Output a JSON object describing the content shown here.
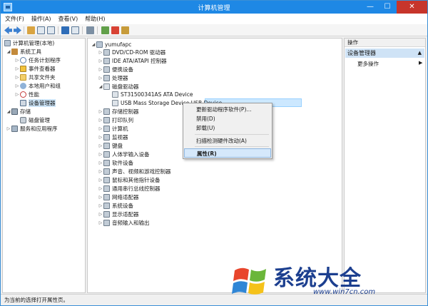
{
  "window": {
    "title": "计算机管理",
    "minimize": "—",
    "maximize": "☐",
    "close": "✕"
  },
  "menu": [
    "文件(F)",
    "操作(A)",
    "查看(V)",
    "帮助(H)"
  ],
  "left_tree": {
    "root": "计算机管理(本地)",
    "system_tools": "系统工具",
    "task_scheduler": "任务计划程序",
    "event_viewer": "事件查看器",
    "shared_folders": "共享文件夹",
    "local_users": "本地用户和组",
    "performance": "性能",
    "device_manager": "设备管理器",
    "storage": "存储",
    "disk_mgmt": "磁盘管理",
    "services": "服务和应用程序"
  },
  "device_tree": {
    "computer": "yumufapc",
    "categories": [
      "DVD/CD-ROM 驱动器",
      "IDE ATA/ATAPI 控制器",
      "便携设备",
      "处理器",
      "磁盘驱动器",
      "存储控制器",
      "打印队列",
      "计算机",
      "监视器",
      "键盘",
      "人体学输入设备",
      "软件设备",
      "声音、视频和游戏控制器",
      "鼠标和其他指针设备",
      "通用串行总线控制器",
      "网络适配器",
      "系统设备",
      "显示适配器",
      "音频输入和输出"
    ],
    "disk_children": [
      "ST31500341AS ATA Device",
      "USB Mass Storage Device USB Device"
    ],
    "selected_device": "USB Mass Storage Device USB Device"
  },
  "context_menu": {
    "items": [
      "更新驱动程序软件(P)...",
      "禁用(D)",
      "卸载(U)",
      "扫描检测硬件改动(A)",
      "属性(R)"
    ],
    "highlighted": "属性(R)"
  },
  "actions": {
    "header": "操作",
    "group": "设备管理器",
    "more": "更多操作"
  },
  "status": "为当前的选择打开属性页。",
  "watermark": {
    "text": "系统大全",
    "url": "www.win7cn.com"
  },
  "colors": {
    "titlebar": "#1e88e5",
    "close": "#c7352b",
    "selection": "#cce8ff",
    "watermark": "#1c3f8f"
  }
}
